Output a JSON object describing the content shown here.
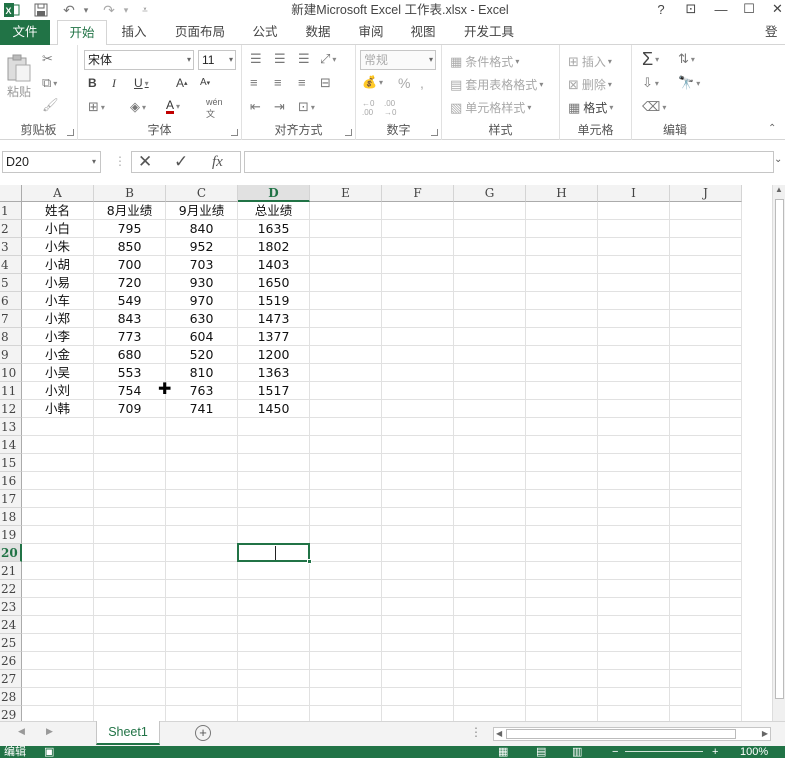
{
  "window": {
    "title": "新建Microsoft Excel 工作表.xlsx - Excel",
    "help": "?",
    "restore_ribbon": "⊡",
    "minimize": "—",
    "maximize": "☐"
  },
  "tabs": {
    "file": "文件",
    "items": [
      "开始",
      "插入",
      "页面布局",
      "公式",
      "数据",
      "审阅",
      "视图",
      "开发工具"
    ],
    "active": "开始",
    "signin": "登录"
  },
  "ribbon": {
    "clipboard": {
      "label": "剪贴板",
      "paste": "粘贴"
    },
    "font": {
      "label": "字体",
      "font_name": "宋体",
      "font_size": "11"
    },
    "alignment": {
      "label": "对齐方式"
    },
    "number": {
      "label": "数字",
      "format": "常规"
    },
    "styles": {
      "label": "样式",
      "conditional": "条件格式",
      "table": "套用表格格式",
      "cell_styles": "单元格样式"
    },
    "cells": {
      "label": "单元格",
      "insert": "插入",
      "delete": "删除",
      "format": "格式"
    },
    "editing": {
      "label": "编辑"
    }
  },
  "formula_bar": {
    "name_box": "D20",
    "fx": "fx",
    "value": ""
  },
  "columns": [
    "A",
    "B",
    "C",
    "D",
    "E",
    "F",
    "G",
    "H",
    "I",
    "J"
  ],
  "rows": [
    "1",
    "2",
    "3",
    "4",
    "5",
    "6",
    "7",
    "8",
    "9",
    "10",
    "11",
    "12",
    "13",
    "14",
    "15",
    "16",
    "17",
    "18",
    "19",
    "20",
    "21",
    "22",
    "23",
    "24",
    "25",
    "26",
    "27",
    "28",
    "29"
  ],
  "selected_cell": "D20",
  "table": {
    "headers": [
      "姓名",
      "8月业绩",
      "9月业绩",
      "总业绩"
    ],
    "rows": [
      [
        "小白",
        "795",
        "840",
        "1635"
      ],
      [
        "小朱",
        "850",
        "952",
        "1802"
      ],
      [
        "小胡",
        "700",
        "703",
        "1403"
      ],
      [
        "小易",
        "720",
        "930",
        "1650"
      ],
      [
        "小车",
        "549",
        "970",
        "1519"
      ],
      [
        "小郑",
        "843",
        "630",
        "1473"
      ],
      [
        "小李",
        "773",
        "604",
        "1377"
      ],
      [
        "小金",
        "680",
        "520",
        "1200"
      ],
      [
        "小吴",
        "553",
        "810",
        "1363"
      ],
      [
        "小刘",
        "754",
        "763",
        "1517"
      ],
      [
        "小韩",
        "709",
        "741",
        "1450"
      ]
    ]
  },
  "sheets": [
    "Sheet1"
  ],
  "status": {
    "mode": "编辑",
    "zoom": "100%"
  }
}
